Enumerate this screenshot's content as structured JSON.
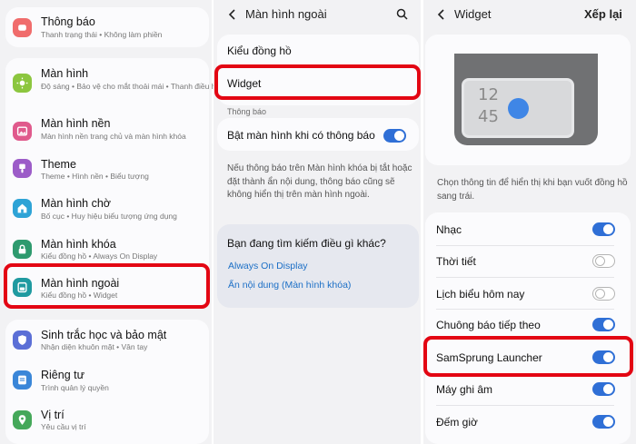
{
  "settings": {
    "items": [
      {
        "title": "Thông báo",
        "subtitle": "Thanh trạng thái • Không làm phiền",
        "icon": "bell-icon",
        "color": "#f06c6c"
      },
      {
        "title": "Màn hình",
        "subtitle": "Độ sáng • Bảo vệ cho mắt thoải mái • Thanh điều hướng",
        "icon": "sun-icon",
        "color": "#8cc63f"
      },
      {
        "title": "Màn hình nền",
        "subtitle": "Màn hình nền trang chủ và màn hình khóa",
        "icon": "image-icon",
        "color": "#e05a8c"
      },
      {
        "title": "Theme",
        "subtitle": "Theme • Hình nền • Biểu tượng",
        "icon": "brush-icon",
        "color": "#9c5cc8"
      },
      {
        "title": "Màn hình chờ",
        "subtitle": "Bố cục • Huy hiệu biểu tượng ứng dụng",
        "icon": "home-icon",
        "color": "#2ea3d6"
      },
      {
        "title": "Màn hình khóa",
        "subtitle": "Kiểu đồng hồ • Always On Display",
        "icon": "lock-icon",
        "color": "#2e9a6e"
      },
      {
        "title": "Màn hình ngoài",
        "subtitle": "Kiểu đồng hồ • Widget",
        "icon": "cover-screen-icon",
        "color": "#1f9aa0"
      },
      {
        "title": "Sinh trắc học và bảo mật",
        "subtitle": "Nhận diện khuôn mặt • Vân tay",
        "icon": "shield-icon",
        "color": "#5b6fd6"
      },
      {
        "title": "Riêng tư",
        "subtitle": "Trình quản lý quyền",
        "icon": "privacy-icon",
        "color": "#3a86d8"
      },
      {
        "title": "Vị trí",
        "subtitle": "Yêu cầu vị trí",
        "icon": "location-icon",
        "color": "#45a85a"
      }
    ]
  },
  "cover": {
    "title": "Màn hình ngoài",
    "clock_style": "Kiểu đồng hồ",
    "widget": "Widget",
    "section_notifications": "Thông báo",
    "turn_on_label": "Bật màn hình khi có thông báo",
    "turn_on_value": true,
    "description": "Nếu thông báo trên Màn hình khóa bị tắt hoặc đặt thành ẩn nội dung, thông báo cũng sẽ không hiển thị trên màn hình ngoài.",
    "suggest_title": "Bạn đang tìm kiếm điều gì khác?",
    "links": [
      "Always On Display",
      "Ẩn nội dung (Màn hình khóa)"
    ]
  },
  "widget": {
    "title": "Widget",
    "reorder": "Xếp lại",
    "preview_time": {
      "hour": "12",
      "minute": "45"
    },
    "hint": "Chọn thông tin để hiển thị khi bạn vuốt đồng hồ sang trái.",
    "items": [
      {
        "label": "Nhạc",
        "on": true
      },
      {
        "label": "Thời tiết",
        "on": false
      },
      {
        "label": "Lịch biểu hôm nay",
        "on": false
      },
      {
        "label": "Chuông báo tiếp theo",
        "on": true
      },
      {
        "label": "SamSprung Launcher",
        "on": true
      },
      {
        "label": "Máy ghi âm",
        "on": true
      },
      {
        "label": "Đếm giờ",
        "on": true
      }
    ]
  },
  "colors": {
    "accent": "#2f6fd6",
    "highlight": "#e30613",
    "link": "#1c6fc6"
  }
}
